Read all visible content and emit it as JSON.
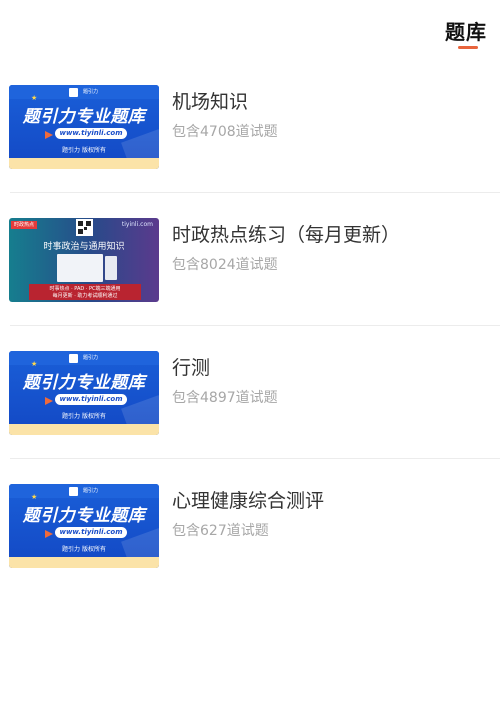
{
  "header": {
    "tab_title": "题库"
  },
  "promo": {
    "headline": "题引力专业题库",
    "url": "www.tiyinli.com",
    "copyright": "题引力 版权所有",
    "logo_text": "题引力"
  },
  "promo_dark": {
    "tag": "时政热点",
    "site": "tiyinli.com",
    "headline": "时事政治与通用知识",
    "line1": "时事热点 · PAD · PC端三端通用",
    "line2": "每月更新 · 助力考试顺利通过"
  },
  "items": [
    {
      "title": "机场知识",
      "subtitle": "包含4708道试题",
      "thumb": "blue"
    },
    {
      "title": "时政热点练习（每月更新）",
      "subtitle": "包含8024道试题",
      "thumb": "dark"
    },
    {
      "title": "行测",
      "subtitle": "包含4897道试题",
      "thumb": "blue"
    },
    {
      "title": "心理健康综合测评",
      "subtitle": "包含627道试题",
      "thumb": "blue"
    }
  ],
  "colors": {
    "accent": "#e8643c",
    "promo_blue": "#1a5fd8",
    "promo_yellow": "#fbe3a8"
  }
}
